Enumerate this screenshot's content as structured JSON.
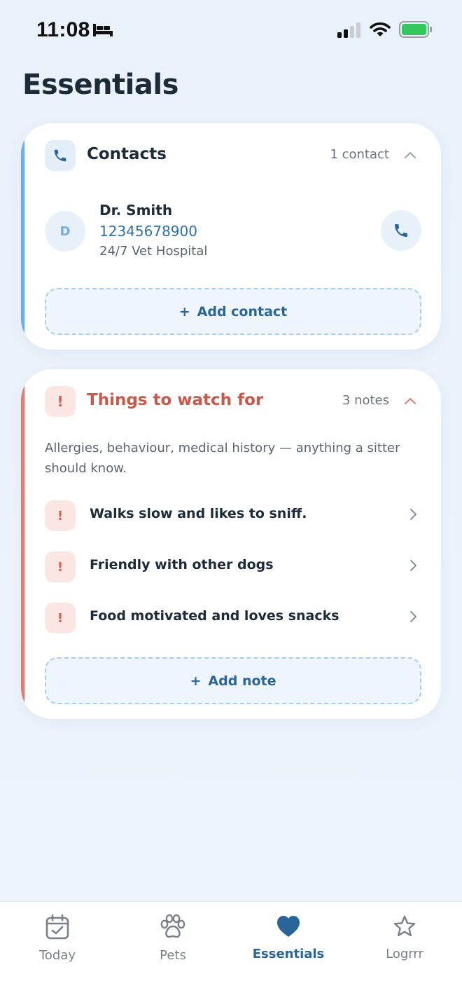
{
  "status_bar": {
    "time": "11:08"
  },
  "page": {
    "title": "Essentials"
  },
  "contacts": {
    "title": "Contacts",
    "count": "1 contact",
    "items": [
      {
        "initial": "D",
        "name": "Dr. Smith",
        "phone": "12345678900",
        "subtitle": "24/7 Vet Hospital"
      }
    ],
    "add_label": "Add contact",
    "accent": "#6aaee6"
  },
  "watch": {
    "title": "Things to watch for",
    "count": "3 notes",
    "description": "Allergies, behaviour, medical history — anything a sitter should know.",
    "notes": [
      {
        "icon": "!",
        "text": "Walks slow and likes to sniff."
      },
      {
        "icon": "!",
        "text": "Friendly with other dogs"
      },
      {
        "icon": "!",
        "text": "Food motivated and loves snacks"
      }
    ],
    "add_label": "Add note",
    "accent": "#e07d70"
  },
  "add_prefix": "+",
  "tabs": [
    {
      "label": "Today",
      "icon": "calendar-check-icon"
    },
    {
      "label": "Pets",
      "icon": "paw-icon"
    },
    {
      "label": "Essentials",
      "icon": "heart-icon",
      "active": true
    },
    {
      "label": "Logrrr",
      "icon": "star-icon"
    }
  ]
}
